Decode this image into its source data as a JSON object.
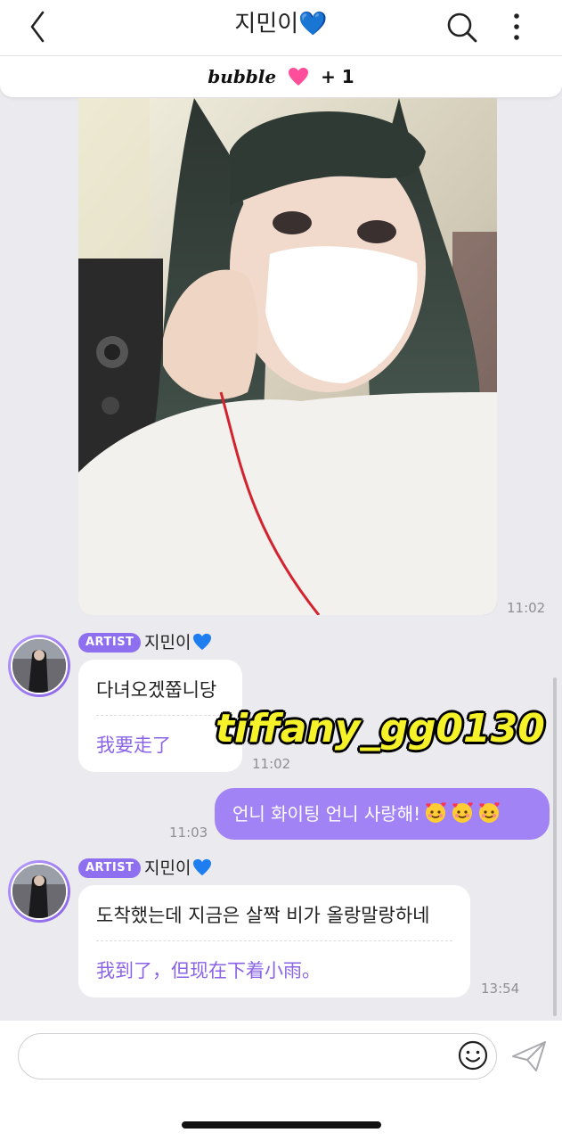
{
  "header": {
    "title": "지민이💙",
    "back_icon": "chevron-left-icon",
    "search_icon": "search-icon",
    "more_icon": "more-vertical-icon"
  },
  "subscription": {
    "brand": "bubble",
    "heart_color": "#ff4f9a",
    "plus_text": "+ 1"
  },
  "messages": [
    {
      "type": "image",
      "time": "11:02"
    },
    {
      "type": "artist",
      "badge": "ARTIST",
      "name": "지민이",
      "korean": "다녀오겠쭙니당",
      "translation": "我要走了",
      "time": "11:02"
    },
    {
      "type": "fan",
      "text": "언니 화이팅 언니 사랑해!🥰🥰🥰",
      "text_main": "언니 화이팅 언니 사랑해!",
      "time": "11:03"
    },
    {
      "type": "artist",
      "badge": "ARTIST",
      "name": "지민이",
      "korean": "도착했는데 지금은 살짝 비가 올랑말랑하네",
      "translation": "我到了，但现在下着小雨。",
      "time": "13:54"
    }
  ],
  "watermark": "tiffany_gg0130",
  "composer": {
    "placeholder": "",
    "emoji_icon": "smiley-icon",
    "send_icon": "send-icon"
  },
  "colors": {
    "accent": "#a283f6",
    "badge": "#8e6ff0",
    "translation": "#8a63e6",
    "background": "#ebeaef",
    "blue_heart": "#1e7ef0"
  }
}
